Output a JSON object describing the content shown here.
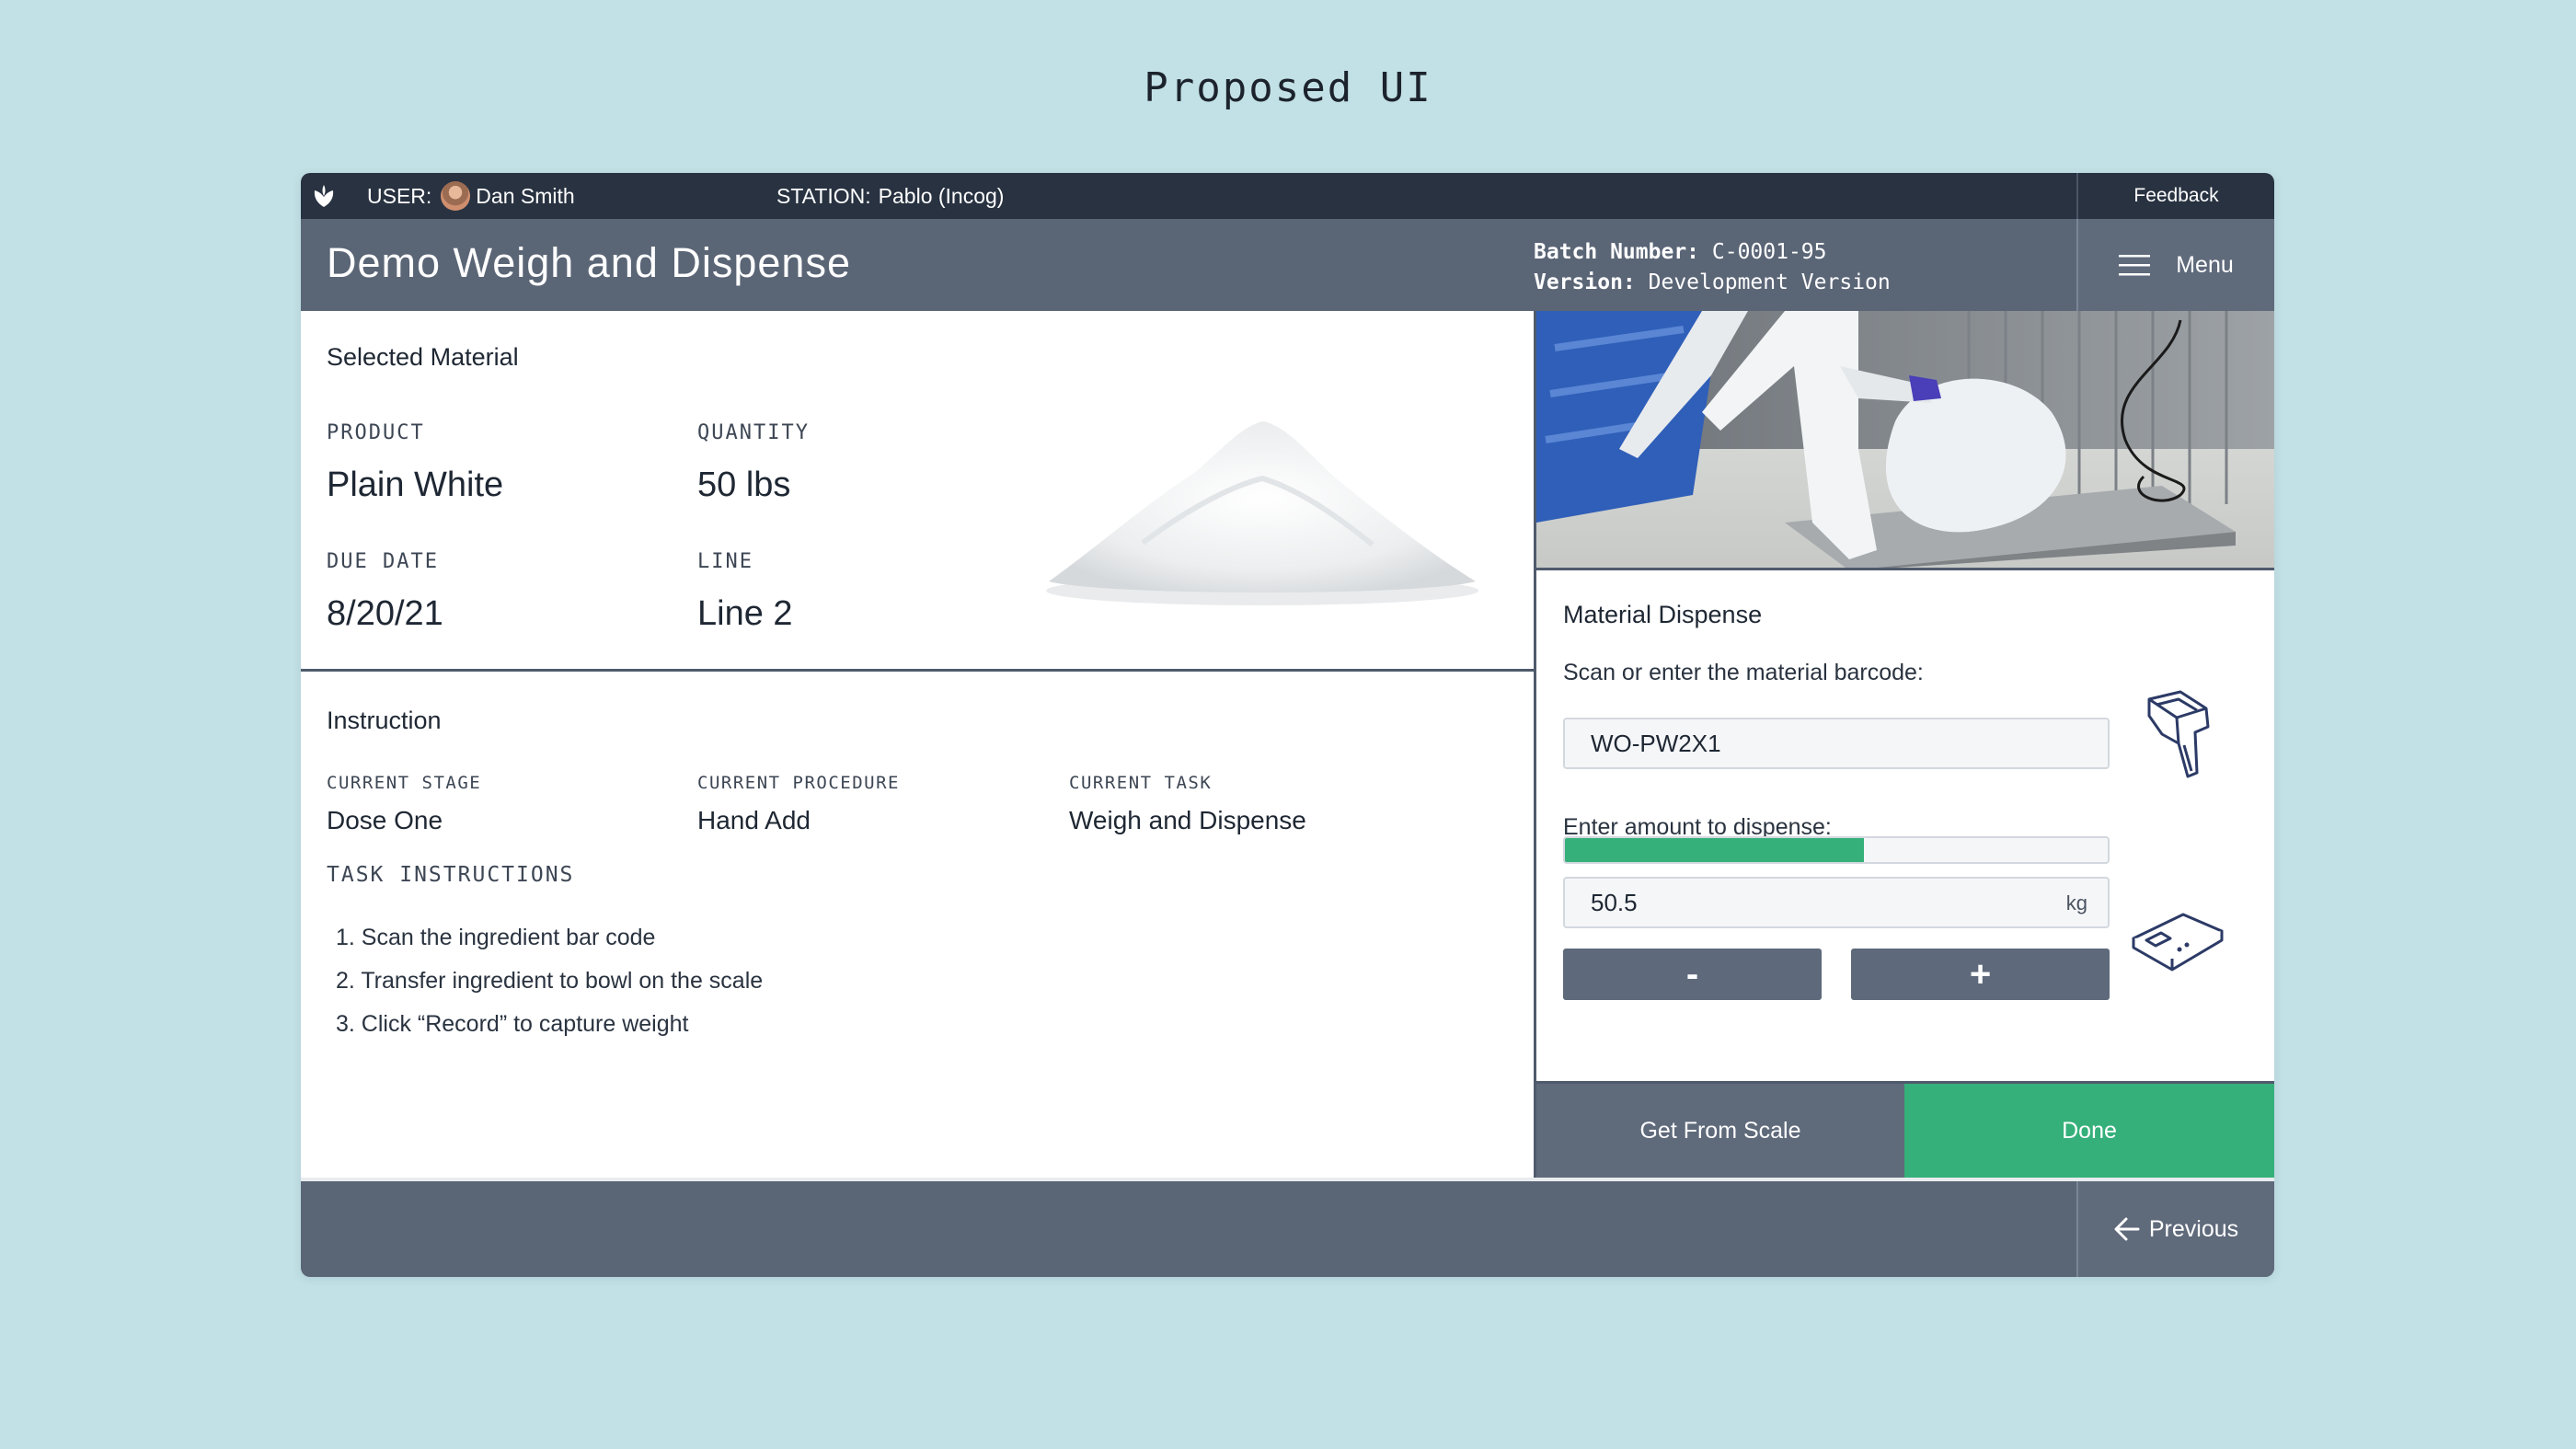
{
  "page": {
    "heading": "Proposed UI"
  },
  "topbar": {
    "user_label": "USER:",
    "user_name": "Dan Smith",
    "station_label": "STATION:",
    "station_name": "Pablo (Incog)",
    "feedback_label": "Feedback"
  },
  "header": {
    "title": "Demo Weigh and Dispense",
    "batch_label": "Batch Number:",
    "batch_value": "C-0001-95",
    "version_label": "Version:",
    "version_value": "Development Version",
    "menu_label": "Menu"
  },
  "material": {
    "title": "Selected Material",
    "product_label": "PRODUCT",
    "product_value": "Plain White",
    "quantity_label": "QUANTITY",
    "quantity_value": "50 lbs",
    "due_label": "DUE DATE",
    "due_value": "8/20/21",
    "line_label": "LINE",
    "line_value": "Line 2"
  },
  "instruction": {
    "title": "Instruction",
    "stage_label": "CURRENT STAGE",
    "stage_value": "Dose One",
    "procedure_label": "CURRENT PROCEDURE",
    "procedure_value": "Hand Add",
    "task_label": "CURRENT TASK",
    "task_value": "Weigh and Dispense",
    "task_instructions_label": "TASK INSTRUCTIONS",
    "steps": [
      "1. Scan the ingredient bar code",
      "2. Transfer ingredient to bowl on the scale",
      "3. Click “Record” to capture weight"
    ]
  },
  "dispense": {
    "title": "Material Dispense",
    "barcode_prompt": "Scan or enter the material barcode:",
    "barcode_value": "WO-PW2X1",
    "amount_prompt": "Enter amount to dispense:",
    "progress_fraction": 0.55,
    "amount_value": "50.5",
    "amount_unit": "kg",
    "minus_label": "-",
    "plus_label": "+"
  },
  "actions": {
    "get_from_scale": "Get From Scale",
    "done": "Done"
  },
  "footer": {
    "previous_label": "Previous"
  },
  "colors": {
    "background": "#c2e1e6",
    "topbar": "#283241",
    "header": "#5a6576",
    "accent_green": "#35b07a",
    "button_gray": "#5f6a7b"
  },
  "icons": {
    "logo": "tulip-logo-icon",
    "menu": "hamburger-icon",
    "scanner": "barcode-scanner-icon",
    "scale": "weigh-scale-icon",
    "previous": "arrow-left-icon"
  }
}
